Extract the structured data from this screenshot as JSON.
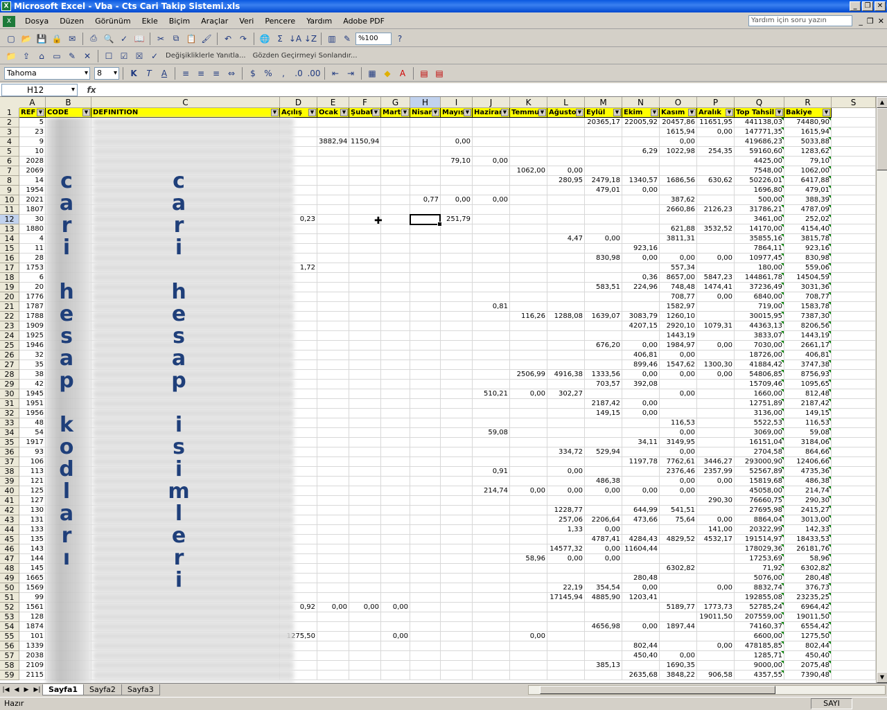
{
  "window": {
    "title": "Microsoft Excel - Vba - Cts Cari Takip Sistemi.xls",
    "app_icon": "excel-icon"
  },
  "menu": {
    "items": [
      "Dosya",
      "Düzen",
      "Görünüm",
      "Ekle",
      "Biçim",
      "Araçlar",
      "Veri",
      "Pencere",
      "Yardım",
      "Adobe PDF"
    ],
    "help_placeholder": "Yardım için soru yazın"
  },
  "toolbar": {
    "zoom": "%100",
    "review_reply": "Değişikliklerle Yanıtla...",
    "review_end": "Gözden Geçirmeyi Sonlandır..."
  },
  "format": {
    "font": "Tahoma",
    "size": "8"
  },
  "formula": {
    "namebox": "H12",
    "fx": "fx",
    "value": ""
  },
  "columns": [
    "A",
    "B",
    "C",
    "D",
    "E",
    "F",
    "G",
    "H",
    "I",
    "J",
    "K",
    "L",
    "M",
    "N",
    "O",
    "P",
    "Q",
    "R",
    "S"
  ],
  "headers": [
    "REF",
    "CODE",
    "DEFINITION",
    "Açılış",
    "Ocak",
    "Şubat",
    "Mart",
    "Nisan",
    "Mayıs",
    "Haziran",
    "Temmuz",
    "Ağustos",
    "Eylül",
    "Ekim",
    "Kasım",
    "Aralık",
    "Top Tahsil",
    "Bakiye",
    ""
  ],
  "overlay": {
    "code_text": [
      "c",
      "a",
      "r",
      "i",
      "",
      "h",
      "e",
      "s",
      "a",
      "p",
      "",
      "k",
      "o",
      "d",
      "l",
      "a",
      "r",
      "ı"
    ],
    "name_text": [
      "c",
      "a",
      "r",
      "i",
      "",
      "h",
      "e",
      "s",
      "a",
      "p",
      "",
      "i",
      "s",
      "i",
      "m",
      "l",
      "e",
      "r",
      "i"
    ]
  },
  "rows": [
    [
      "5",
      "",
      "",
      "",
      "",
      "",
      "",
      "",
      "",
      "",
      "",
      "",
      "20365,17",
      "22005,92",
      "20457,86",
      "11651,95",
      "441138,03",
      "74480,90"
    ],
    [
      "23",
      "",
      "",
      "",
      "",
      "",
      "",
      "",
      "",
      "",
      "",
      "",
      "",
      "",
      "1615,94",
      "0,00",
      "147771,35",
      "1615,94"
    ],
    [
      "9",
      "",
      "",
      "",
      "3882,94",
      "1150,94",
      "",
      "",
      "0,00",
      "",
      "",
      "",
      "",
      "",
      "0,00",
      "",
      "419686,23",
      "5033,88"
    ],
    [
      "10",
      "",
      "",
      "",
      "",
      "",
      "",
      "",
      "",
      "",
      "",
      "",
      "",
      "6,29",
      "1022,98",
      "254,35",
      "59160,60",
      "1283,62"
    ],
    [
      "2028",
      "",
      "",
      "",
      "",
      "",
      "",
      "",
      "79,10",
      "0,00",
      "",
      "",
      "",
      "",
      "",
      "",
      "4425,00",
      "79,10"
    ],
    [
      "2069",
      "",
      "",
      "",
      "",
      "",
      "",
      "",
      "",
      "",
      "1062,00",
      "0,00",
      "",
      "",
      "",
      "",
      "7548,00",
      "1062,00"
    ],
    [
      "14",
      "",
      "",
      "",
      "",
      "",
      "",
      "",
      "",
      "",
      "",
      "280,95",
      "2479,18",
      "1340,57",
      "1686,56",
      "630,62",
      "50226,01",
      "6417,88"
    ],
    [
      "1954",
      "",
      "",
      "",
      "",
      "",
      "",
      "",
      "",
      "",
      "",
      "",
      "479,01",
      "0,00",
      "",
      "",
      "1696,80",
      "479,01"
    ],
    [
      "2021",
      "",
      "",
      "",
      "",
      "",
      "",
      "0,77",
      "0,00",
      "0,00",
      "",
      "",
      "",
      "",
      "387,62",
      "",
      "500,00",
      "388,39"
    ],
    [
      "1807",
      "",
      "",
      "",
      "",
      "",
      "",
      "",
      "",
      "",
      "",
      "",
      "",
      "",
      "2660,86",
      "2126,23",
      "31786,21",
      "4787,09"
    ],
    [
      "30",
      "",
      "",
      "0,23",
      "",
      "",
      "",
      "",
      "251,79",
      "",
      "",
      "",
      "",
      "",
      "",
      "",
      "3461,00",
      "252,02"
    ],
    [
      "1880",
      "",
      "",
      "",
      "",
      "",
      "",
      "",
      "",
      "",
      "",
      "",
      "",
      "",
      "621,88",
      "3532,52",
      "14170,00",
      "4154,40"
    ],
    [
      "4",
      "",
      "",
      "",
      "",
      "",
      "",
      "",
      "",
      "",
      "",
      "4,47",
      "0,00",
      "",
      "3811,31",
      "",
      "35855,16",
      "3815,78"
    ],
    [
      "11",
      "",
      "",
      "",
      "",
      "",
      "",
      "",
      "",
      "",
      "",
      "",
      "",
      "923,16",
      "",
      "",
      "7864,11",
      "923,16"
    ],
    [
      "28",
      "",
      "",
      "",
      "",
      "",
      "",
      "",
      "",
      "",
      "",
      "",
      "830,98",
      "0,00",
      "0,00",
      "0,00",
      "10977,45",
      "830,98"
    ],
    [
      "1753",
      "",
      "",
      "1,72",
      "",
      "",
      "",
      "",
      "",
      "",
      "",
      "",
      "",
      "",
      "557,34",
      "",
      "180,00",
      "559,06"
    ],
    [
      "6",
      "",
      "",
      "",
      "",
      "",
      "",
      "",
      "",
      "",
      "",
      "",
      "",
      "0,36",
      "8657,00",
      "5847,23",
      "144861,78",
      "14504,59"
    ],
    [
      "20",
      "",
      "",
      "",
      "",
      "",
      "",
      "",
      "",
      "",
      "",
      "",
      "583,51",
      "224,96",
      "748,48",
      "1474,41",
      "37236,49",
      "3031,36"
    ],
    [
      "1776",
      "",
      "",
      "",
      "",
      "",
      "",
      "",
      "",
      "",
      "",
      "",
      "",
      "",
      "708,77",
      "0,00",
      "6840,00",
      "708,77"
    ],
    [
      "1787",
      "",
      "",
      "",
      "",
      "",
      "",
      "",
      "",
      "0,81",
      "",
      "",
      "",
      "",
      "1582,97",
      "",
      "719,00",
      "1583,78"
    ],
    [
      "1788",
      "",
      "",
      "",
      "",
      "",
      "",
      "",
      "",
      "",
      "116,26",
      "1288,08",
      "1639,07",
      "3083,79",
      "1260,10",
      "",
      "30015,95",
      "7387,30"
    ],
    [
      "1909",
      "",
      "",
      "",
      "",
      "",
      "",
      "",
      "",
      "",
      "",
      "",
      "",
      "4207,15",
      "2920,10",
      "1079,31",
      "44363,13",
      "8206,56"
    ],
    [
      "1925",
      "",
      "",
      "",
      "",
      "",
      "",
      "",
      "",
      "",
      "",
      "",
      "",
      "",
      "1443,19",
      "",
      "3833,07",
      "1443,19"
    ],
    [
      "1946",
      "",
      "",
      "",
      "",
      "",
      "",
      "",
      "",
      "",
      "",
      "",
      "676,20",
      "0,00",
      "1984,97",
      "0,00",
      "7030,00",
      "2661,17"
    ],
    [
      "32",
      "",
      "",
      "",
      "",
      "",
      "",
      "",
      "",
      "",
      "",
      "",
      "",
      "406,81",
      "0,00",
      "",
      "18726,00",
      "406,81"
    ],
    [
      "35",
      "",
      "",
      "",
      "",
      "",
      "",
      "",
      "",
      "",
      "",
      "",
      "",
      "899,46",
      "1547,62",
      "1300,30",
      "41884,42",
      "3747,38"
    ],
    [
      "38",
      "",
      "",
      "",
      "",
      "",
      "",
      "",
      "",
      "",
      "2506,99",
      "4916,38",
      "1333,56",
      "0,00",
      "0,00",
      "0,00",
      "54806,85",
      "8756,93"
    ],
    [
      "42",
      "",
      "",
      "",
      "",
      "",
      "",
      "",
      "",
      "",
      "",
      "",
      "703,57",
      "392,08",
      "",
      "",
      "15709,46",
      "1095,65"
    ],
    [
      "1945",
      "",
      "",
      "",
      "",
      "",
      "",
      "",
      "",
      "510,21",
      "0,00",
      "302,27",
      "",
      "",
      "0,00",
      "",
      "1660,00",
      "812,48"
    ],
    [
      "1951",
      "",
      "",
      "",
      "",
      "",
      "",
      "",
      "",
      "",
      "",
      "",
      "2187,42",
      "0,00",
      "",
      "",
      "12751,89",
      "2187,42"
    ],
    [
      "1956",
      "",
      "",
      "",
      "",
      "",
      "",
      "",
      "",
      "",
      "",
      "",
      "149,15",
      "0,00",
      "",
      "",
      "3136,00",
      "149,15"
    ],
    [
      "48",
      "",
      "",
      "",
      "",
      "",
      "",
      "",
      "",
      "",
      "",
      "",
      "",
      "",
      "116,53",
      "",
      "5522,53",
      "116,53"
    ],
    [
      "54",
      "",
      "",
      "",
      "",
      "",
      "",
      "",
      "",
      "59,08",
      "",
      "",
      "",
      "",
      "0,00",
      "",
      "3069,00",
      "59,08"
    ],
    [
      "1917",
      "",
      "",
      "",
      "",
      "",
      "",
      "",
      "",
      "",
      "",
      "",
      "",
      "34,11",
      "3149,95",
      "",
      "16151,04",
      "3184,06"
    ],
    [
      "93",
      "",
      "",
      "",
      "",
      "",
      "",
      "",
      "",
      "",
      "",
      "334,72",
      "529,94",
      "",
      "0,00",
      "",
      "2704,58",
      "864,66"
    ],
    [
      "106",
      "",
      "",
      "",
      "",
      "",
      "",
      "",
      "",
      "",
      "",
      "",
      "",
      "1197,78",
      "7762,61",
      "3446,27",
      "293000,90",
      "12406,66"
    ],
    [
      "113",
      "",
      "",
      "",
      "",
      "",
      "",
      "",
      "",
      "0,91",
      "",
      "0,00",
      "",
      "",
      "2376,46",
      "2357,99",
      "52567,89",
      "4735,36"
    ],
    [
      "121",
      "",
      "",
      "",
      "",
      "",
      "",
      "",
      "",
      "",
      "",
      "",
      "486,38",
      "",
      "0,00",
      "0,00",
      "15819,68",
      "486,38"
    ],
    [
      "125",
      "",
      "",
      "",
      "",
      "",
      "",
      "",
      "",
      "214,74",
      "0,00",
      "0,00",
      "0,00",
      "0,00",
      "0,00",
      "",
      "45058,00",
      "214,74"
    ],
    [
      "127",
      "",
      "",
      "",
      "",
      "",
      "",
      "",
      "",
      "",
      "",
      "",
      "",
      "",
      "",
      "290,30",
      "76660,75",
      "290,30"
    ],
    [
      "130",
      "",
      "",
      "",
      "",
      "",
      "",
      "",
      "",
      "",
      "",
      "1228,77",
      "",
      "644,99",
      "541,51",
      "",
      "27695,98",
      "2415,27"
    ],
    [
      "131",
      "",
      "",
      "",
      "",
      "",
      "",
      "",
      "",
      "",
      "",
      "257,06",
      "2206,64",
      "473,66",
      "75,64",
      "0,00",
      "8864,04",
      "3013,00"
    ],
    [
      "133",
      "",
      "",
      "",
      "",
      "",
      "",
      "",
      "",
      "",
      "",
      "1,33",
      "0,00",
      "",
      "",
      "141,00",
      "20322,99",
      "142,33"
    ],
    [
      "135",
      "",
      "",
      "",
      "",
      "",
      "",
      "",
      "",
      "",
      "",
      "",
      "4787,41",
      "4284,43",
      "4829,52",
      "4532,17",
      "191514,97",
      "18433,53"
    ],
    [
      "143",
      "",
      "",
      "",
      "",
      "",
      "",
      "",
      "",
      "",
      "",
      "14577,32",
      "0,00",
      "11604,44",
      "",
      "",
      "178029,36",
      "26181,76"
    ],
    [
      "144",
      "",
      "",
      "",
      "",
      "",
      "",
      "",
      "",
      "",
      "58,96",
      "0,00",
      "0,00",
      "",
      "",
      "",
      "17253,69",
      "58,96"
    ],
    [
      "145",
      "",
      "",
      "",
      "",
      "",
      "",
      "",
      "",
      "",
      "",
      "",
      "",
      "",
      "6302,82",
      "",
      "71,92",
      "6302,82"
    ],
    [
      "1665",
      "",
      "",
      "",
      "",
      "",
      "",
      "",
      "",
      "",
      "",
      "",
      "",
      "280,48",
      "",
      "",
      "5076,00",
      "280,48"
    ],
    [
      "1569",
      "",
      "",
      "",
      "",
      "",
      "",
      "",
      "",
      "",
      "",
      "22,19",
      "354,54",
      "0,00",
      "",
      "0,00",
      "8832,74",
      "376,73"
    ],
    [
      "99",
      "",
      "",
      "",
      "",
      "",
      "",
      "",
      "",
      "",
      "",
      "17145,94",
      "4885,90",
      "1203,41",
      "",
      "",
      "192855,08",
      "23235,25"
    ],
    [
      "1561",
      "",
      "",
      "0,92",
      "0,00",
      "0,00",
      "0,00",
      "",
      "",
      "",
      "",
      "",
      "",
      "",
      "5189,77",
      "1773,73",
      "52785,24",
      "6964,42"
    ],
    [
      "128",
      "",
      "",
      "",
      "",
      "",
      "",
      "",
      "",
      "",
      "",
      "",
      "",
      "",
      "",
      "19011,50",
      "207559,00",
      "19011,50"
    ],
    [
      "1874",
      "",
      "",
      "",
      "",
      "",
      "",
      "",
      "",
      "",
      "",
      "",
      "4656,98",
      "0,00",
      "1897,44",
      "",
      "74160,37",
      "6554,42"
    ],
    [
      "101",
      "",
      "",
      "1275,50",
      "",
      "",
      "0,00",
      "",
      "",
      "",
      "0,00",
      "",
      "",
      "",
      "",
      "",
      "6600,00",
      "1275,50"
    ],
    [
      "1339",
      "",
      "",
      "",
      "",
      "",
      "",
      "",
      "",
      "",
      "",
      "",
      "",
      "802,44",
      "",
      "0,00",
      "478185,85",
      "802,44"
    ],
    [
      "2038",
      "",
      "",
      "",
      "",
      "",
      "",
      "",
      "",
      "",
      "",
      "",
      "",
      "450,40",
      "0,00",
      "",
      "1285,71",
      "450,40"
    ],
    [
      "2109",
      "",
      "",
      "",
      "",
      "",
      "",
      "",
      "",
      "",
      "",
      "",
      "385,13",
      "",
      "1690,35",
      "",
      "9000,00",
      "2075,48"
    ],
    [
      "2115",
      "",
      "",
      "",
      "",
      "",
      "",
      "",
      "",
      "",
      "",
      "",
      "",
      "2635,68",
      "3848,22",
      "906,58",
      "4357,55",
      "7390,48"
    ]
  ],
  "selected": {
    "row": 12,
    "col": "H"
  },
  "sheets": [
    "Sayfa1",
    "Sayfa2",
    "Sayfa3"
  ],
  "status": {
    "left": "Hazır",
    "right": "SAYI"
  }
}
